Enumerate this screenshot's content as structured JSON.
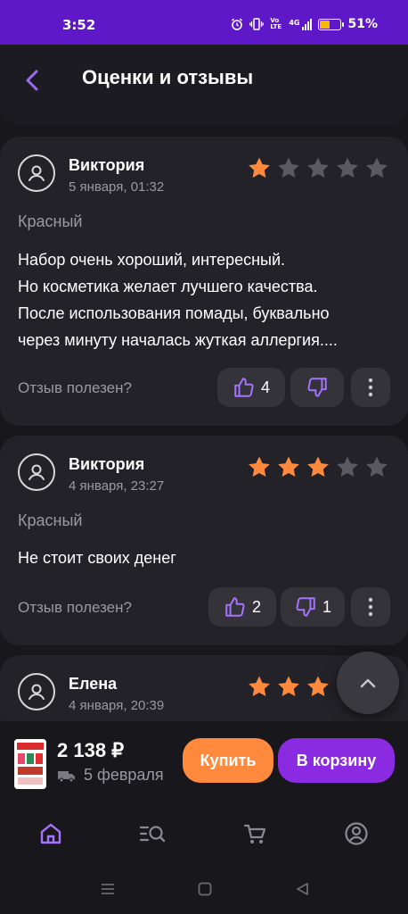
{
  "status_bar": {
    "time": "3:52",
    "battery_percent": "51%",
    "battery_level": 0.51,
    "icons": [
      "alarm-icon",
      "vibrate-icon",
      "volte-icon",
      "signal-4g-icon",
      "battery-icon"
    ],
    "volte_label": "Vo LTE",
    "network_label": "4G",
    "bg_color": "#5f18c8"
  },
  "header": {
    "title": "Оценки и отзывы",
    "back_icon": "chevron-left-icon",
    "accent": "#9d6bf0"
  },
  "reviews": [
    {
      "author": "Виктория",
      "date": "5 января, 01:32",
      "rating": 1,
      "max_rating": 5,
      "variant": "Красный",
      "text_lines": [
        "Набор очень хороший, интересный.",
        "Но косметика желает лучшего качества.",
        "После использования помады, буквально",
        "через минуту началась жуткая аллергия...."
      ],
      "helpful_label": "Отзыв полезен?",
      "likes": "4",
      "dislikes": ""
    },
    {
      "author": "Виктория",
      "date": "4 января, 23:27",
      "rating": 3,
      "max_rating": 5,
      "variant": "Красный",
      "text_lines": [
        "Не стоит своих денег"
      ],
      "helpful_label": "Отзыв полезен?",
      "likes": "2",
      "dislikes": "1"
    },
    {
      "author": "Елена",
      "date": "4 января, 20:39",
      "rating": 3,
      "max_rating": 5
    }
  ],
  "colors": {
    "star_filled": "#ff8a3d",
    "star_empty": "#5a5962",
    "thumb": "#a774ff"
  },
  "buy_bar": {
    "price": "2 138 ₽",
    "delivery": "5 февраля",
    "buy_label": "Купить",
    "cart_label": "В корзину"
  },
  "tabs": [
    {
      "icon": "home-icon",
      "active": true
    },
    {
      "icon": "catalog-search-icon",
      "active": false
    },
    {
      "icon": "cart-icon",
      "active": false
    },
    {
      "icon": "profile-icon",
      "active": false
    }
  ]
}
